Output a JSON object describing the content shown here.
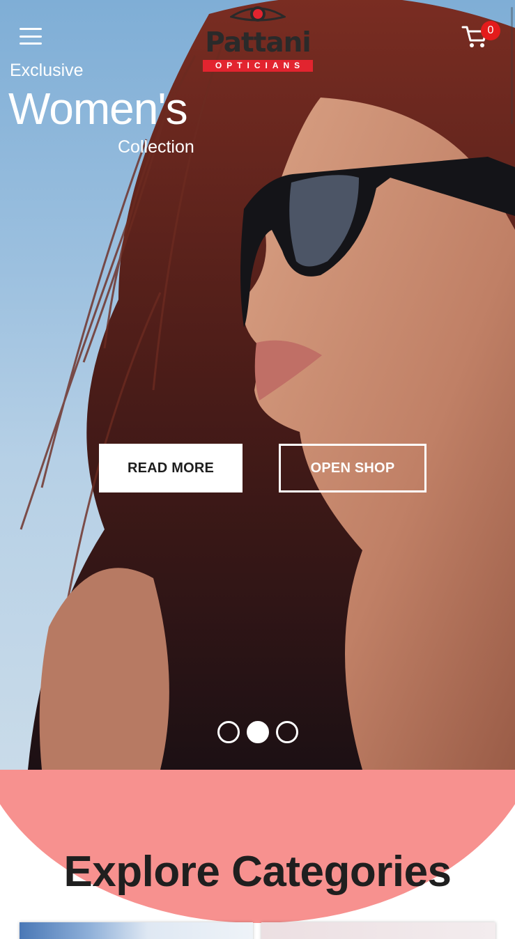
{
  "header": {
    "menu_icon": "hamburger-menu-icon",
    "logo": {
      "word": "Pattani",
      "sub": "OPTICIANS",
      "brand_red": "#e2242f"
    },
    "cart": {
      "icon": "shopping-cart-icon",
      "count": "0",
      "badge_color": "#e41b1b"
    }
  },
  "hero": {
    "kicker": "Exclusive",
    "headline": "Women's",
    "subline": "Collection",
    "read_more_label": "READ MORE",
    "open_shop_label": "OPEN SHOP",
    "slider": {
      "slides": 3,
      "active_index": 1
    }
  },
  "explore": {
    "title": "Explore Categories",
    "accent_color": "#f7918f"
  }
}
